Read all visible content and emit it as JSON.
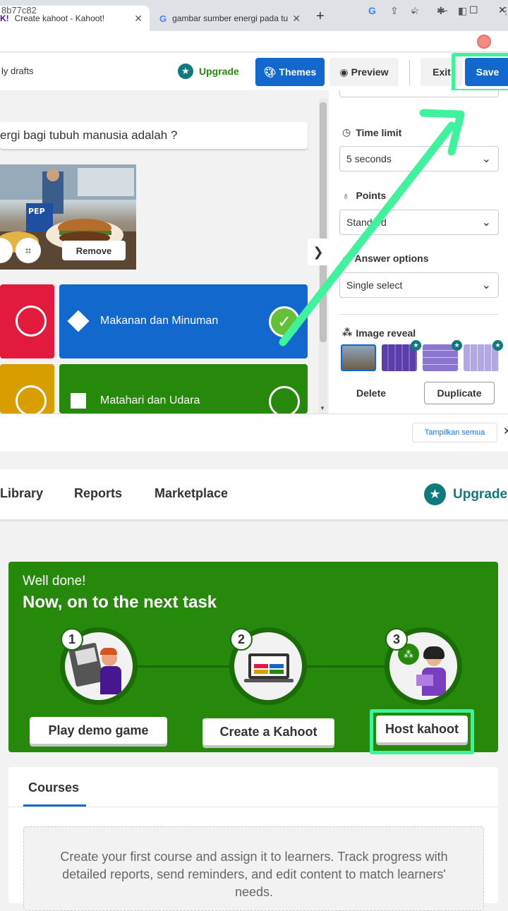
{
  "browser": {
    "tabs": [
      {
        "favicon": "K!",
        "title": "Create kahoot - Kahoot!"
      },
      {
        "favicon": "G",
        "title": "gambar sumber energi pada tubuh"
      }
    ],
    "new_tab": "+",
    "url": "8b77c82",
    "window_controls": [
      "⌄",
      "—",
      "☐",
      "✕"
    ]
  },
  "editor": {
    "drafts_label": "ly drafts",
    "upgrade": "Upgrade",
    "themes": "Themes",
    "preview": "Preview",
    "exit": "Exit",
    "save": "Save",
    "question": "ergi bagi tubuh manusia adalah ?",
    "image_remove": "Remove",
    "answers": [
      {
        "text": "Makanan dan Minuman",
        "color": "#1368ce",
        "correct": true
      },
      {
        "text": "Matahari dan Udara",
        "color": "#26890c",
        "correct": false
      }
    ],
    "panel": {
      "time_limit_label": "Time limit",
      "time_limit_value": "5 seconds",
      "points_label": "Points",
      "points_value": "Standard",
      "answer_options_label": "Answer options",
      "answer_options_value": "Single select",
      "image_reveal_label": "Image reveal",
      "delete": "Delete",
      "duplicate": "Duplicate"
    },
    "show_all": "Tampilkan semua",
    "show_all_close": "✕"
  },
  "dashboard": {
    "nav": [
      "Library",
      "Reports",
      "Marketplace"
    ],
    "upgrade": "Upgrade",
    "card": {
      "greeting": "Well done!",
      "heading": "Now, on to the next task",
      "steps": [
        {
          "num": "1",
          "button": "Play demo game"
        },
        {
          "num": "2",
          "button": "Create a Kahoot"
        },
        {
          "num": "3",
          "button": "Host kahoot"
        }
      ]
    },
    "courses": {
      "tab": "Courses",
      "empty_text": "Create your first course and assign it to learners. Track progress with detailed reports, send reminders, and edit content to match learners' needs."
    }
  },
  "colors": {
    "highlight": "#3ef39b",
    "kahoot_blue": "#1368ce",
    "kahoot_green": "#26890c",
    "kahoot_red": "#e21b3c",
    "kahoot_yellow": "#d89e00",
    "teal": "#0e7a7e"
  }
}
